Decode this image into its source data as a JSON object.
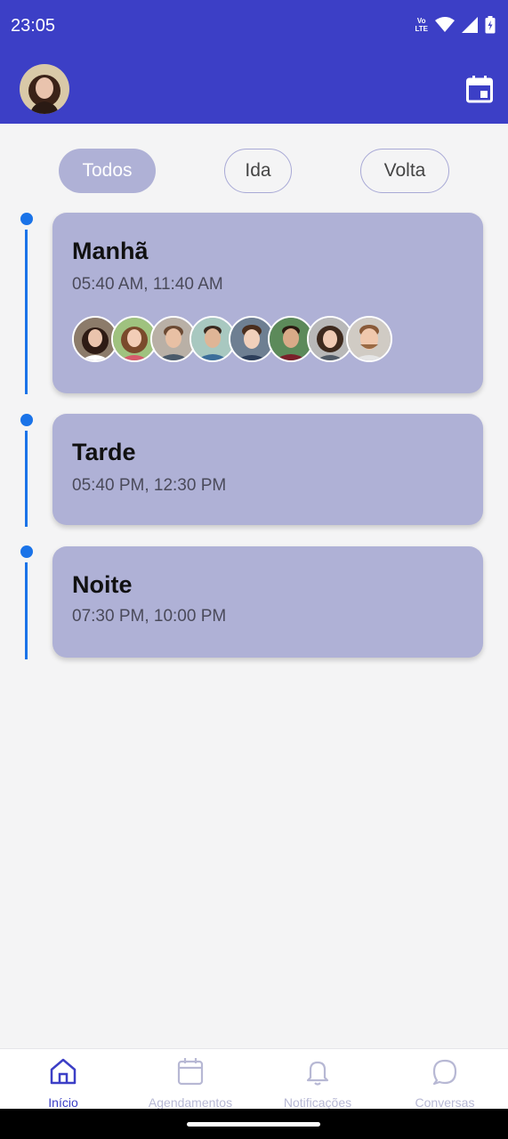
{
  "status_bar": {
    "time": "23:05",
    "network_badge_top": "Vo",
    "network_badge_bottom": "LTE"
  },
  "header": {
    "avatar_icon": "profile-avatar",
    "calendar_icon": "calendar-icon"
  },
  "filters": [
    {
      "label": "Todos",
      "active": true
    },
    {
      "label": "Ida",
      "active": false
    },
    {
      "label": "Volta",
      "active": false
    }
  ],
  "periods": [
    {
      "title": "Manhã",
      "times": "05:40 AM, 11:40 AM",
      "passenger_count": 8
    },
    {
      "title": "Tarde",
      "times": "05:40 PM, 12:30 PM"
    },
    {
      "title": "Noite",
      "times": "07:30 PM, 10:00 PM"
    }
  ],
  "bottom_nav": [
    {
      "label": "Início",
      "icon": "home-icon",
      "active": true
    },
    {
      "label": "Agendamentos",
      "icon": "calendar-icon",
      "active": false
    },
    {
      "label": "Notificações",
      "icon": "bell-icon",
      "active": false
    },
    {
      "label": "Conversas",
      "icon": "chat-bubble-icon",
      "active": false
    }
  ],
  "colors": {
    "primary": "#3c3fc6",
    "card": "#afb1d6",
    "timeline": "#1a73e8",
    "background": "#f4f4f5"
  }
}
